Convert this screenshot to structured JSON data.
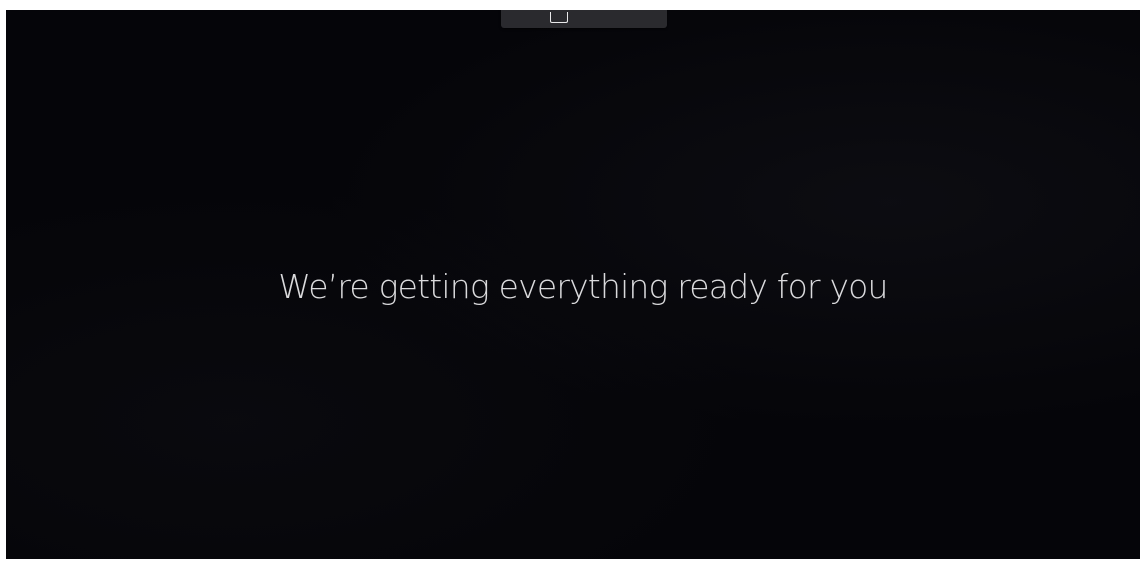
{
  "screen": {
    "message": "We’re getting everything ready for you"
  },
  "toolbar": {
    "icon": "minimize-window-icon"
  },
  "colors": {
    "background": "#050509",
    "text": "#e8e8ea",
    "toolbar": "#2a2a2e"
  }
}
